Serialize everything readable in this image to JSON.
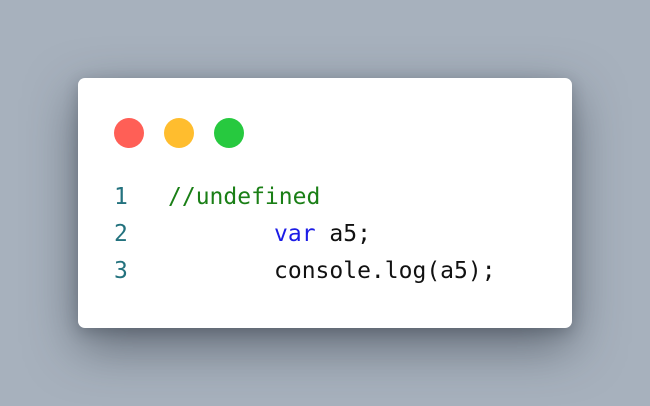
{
  "window": {
    "controls": [
      {
        "name": "close",
        "color": "#ff5f56"
      },
      {
        "name": "minimize",
        "color": "#ffbd2e"
      },
      {
        "name": "maximize",
        "color": "#27c93f"
      }
    ]
  },
  "editor": {
    "colors": {
      "line_number": "#23727e",
      "comment": "#1a7f16",
      "keyword": "#1c1ce6",
      "text": "#111111"
    },
    "lines": [
      {
        "number": "1",
        "comment": "//undefined"
      },
      {
        "number": "2",
        "keyword": "var",
        "rest": " a5;"
      },
      {
        "number": "3",
        "text": "console.log(a5);"
      }
    ]
  }
}
